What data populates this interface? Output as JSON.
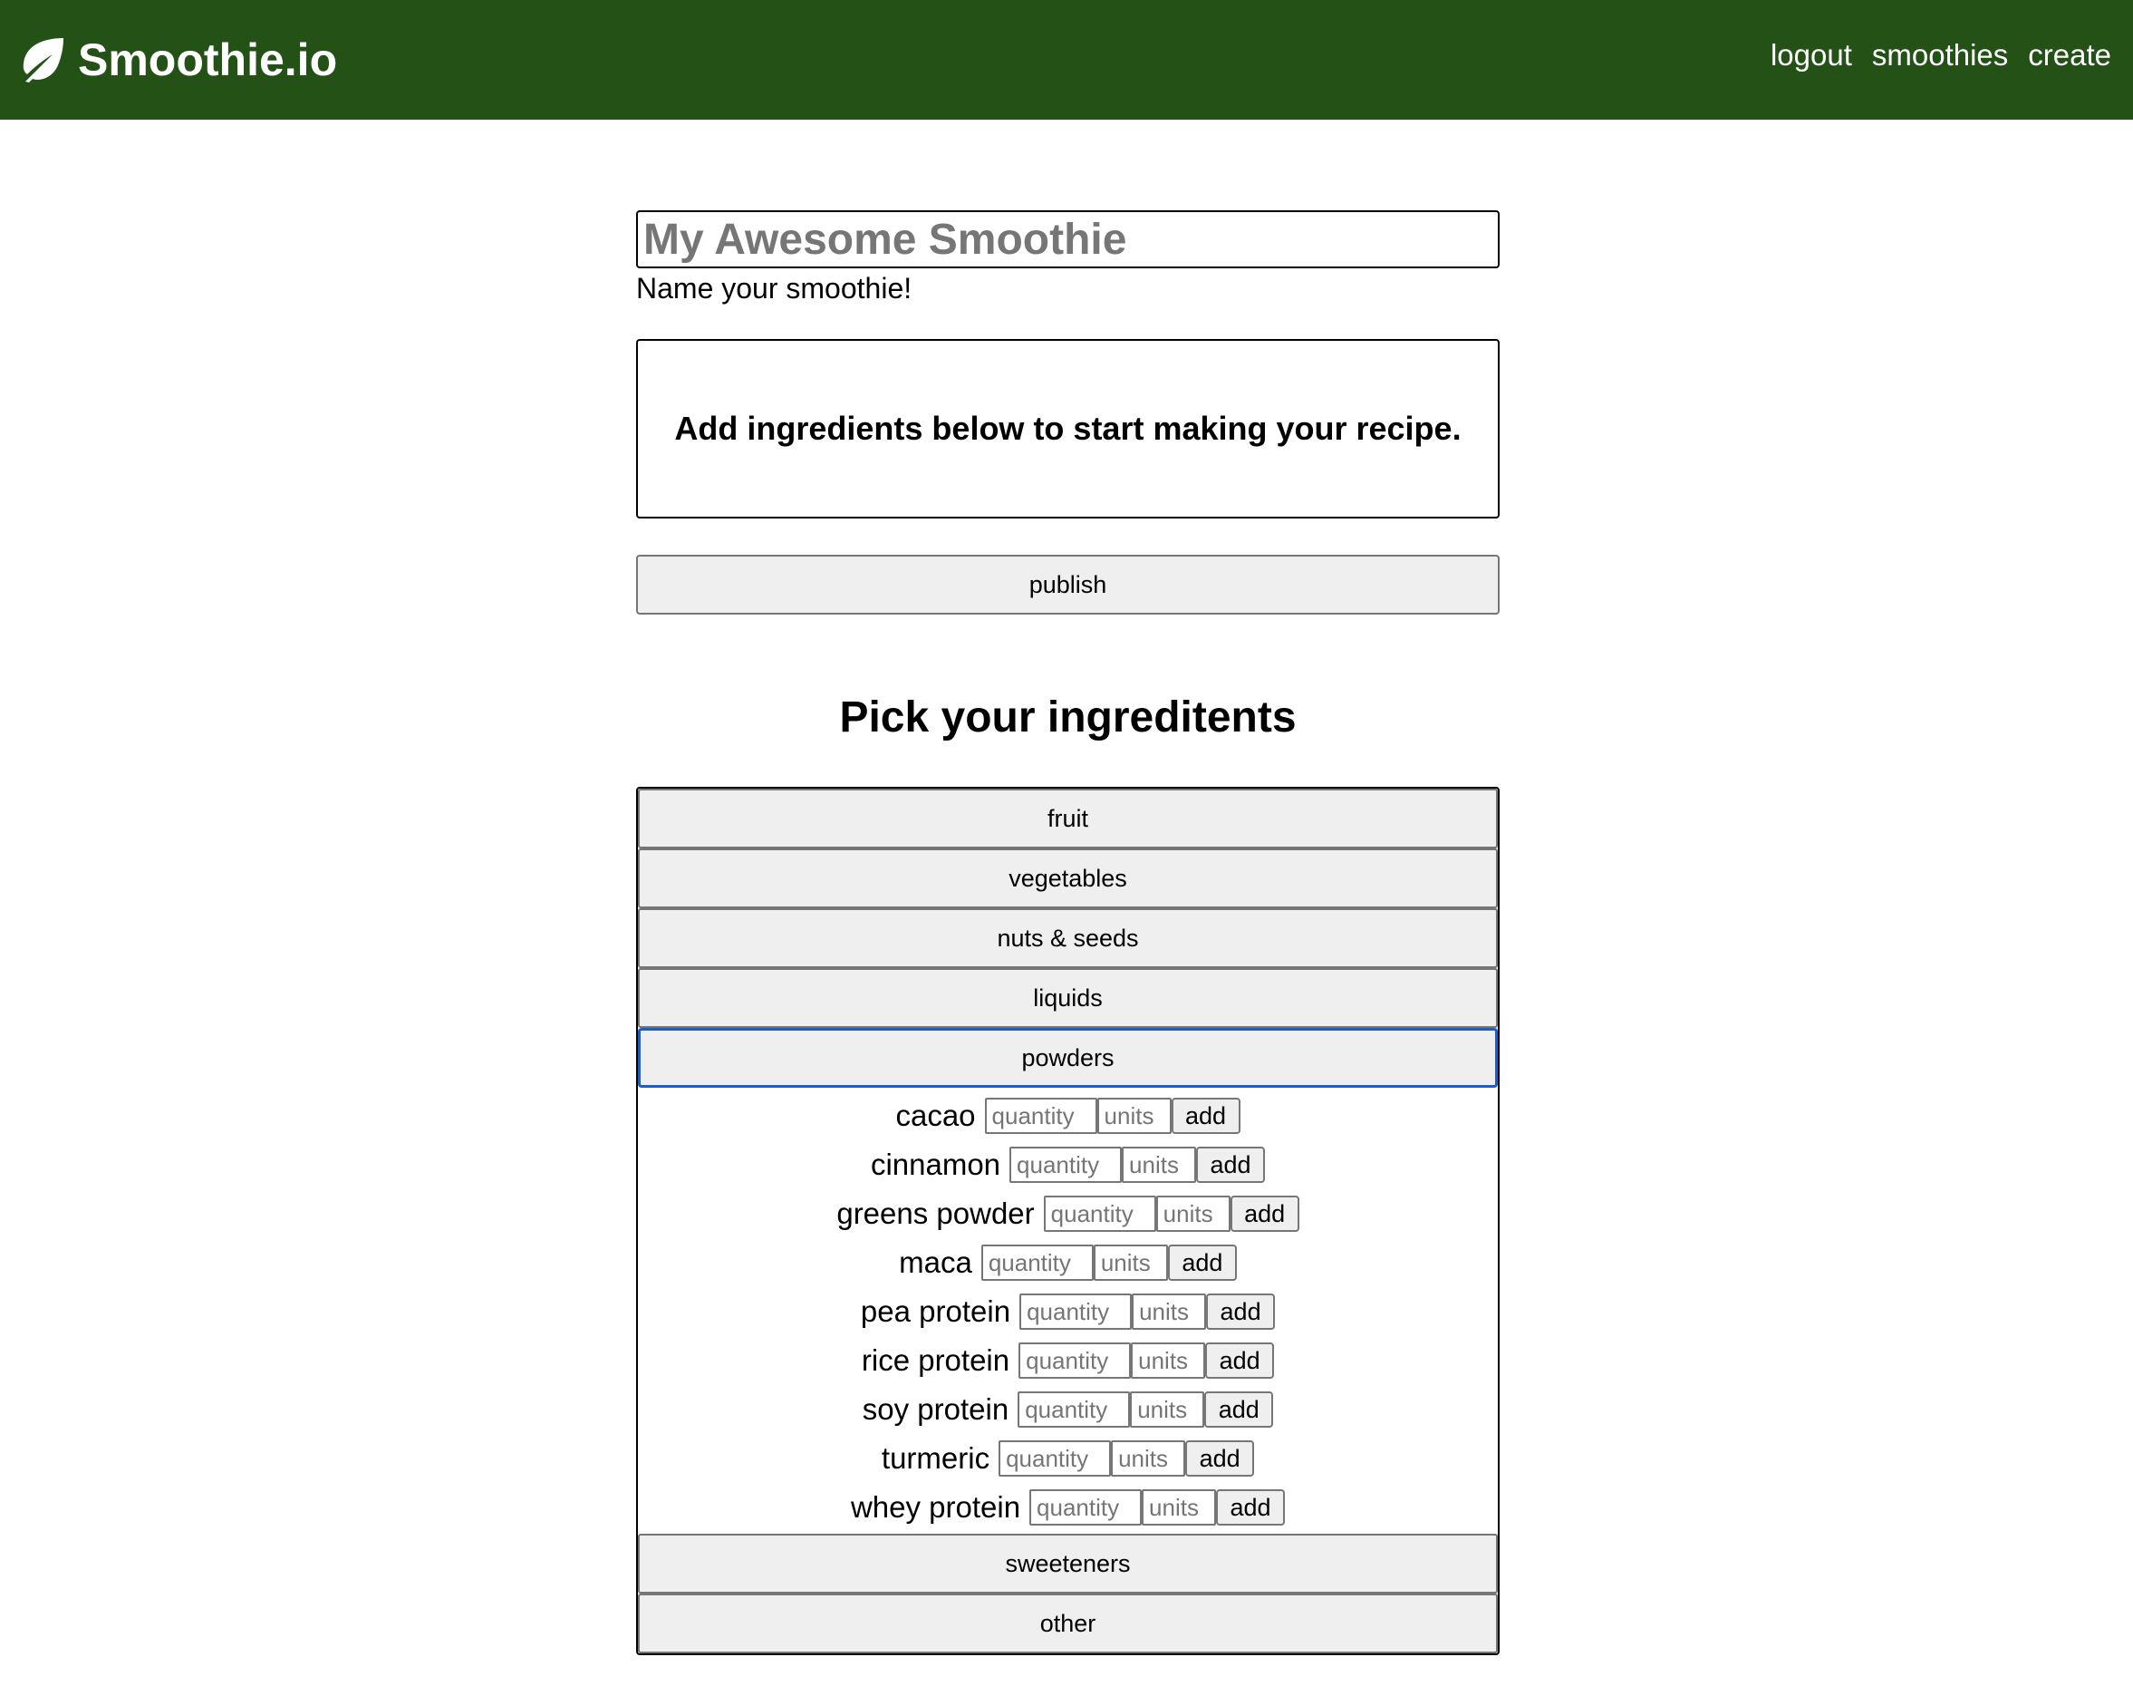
{
  "header": {
    "brand": "Smoothie.io",
    "nav": [
      "logout",
      "smoothies",
      "create"
    ],
    "logo_icon": "leaf-icon",
    "bg_color": "#235116"
  },
  "form": {
    "name_placeholder": "My Awesome Smoothie",
    "name_help": "Name your smoothie!",
    "recipe_empty_message": "Add ingredients below to start making your recipe.",
    "publish_label": "publish"
  },
  "picker": {
    "title": "Pick your ingreditents",
    "categories_before": [
      "fruit",
      "vegetables",
      "nuts & seeds",
      "liquids"
    ],
    "open_category": "powders",
    "categories_after": [
      "sweeteners",
      "other"
    ],
    "qty_placeholder": "quantity",
    "units_placeholder": "units",
    "add_label": "add",
    "ingredients": [
      "cacao",
      "cinnamon",
      "greens powder",
      "maca",
      "pea protein",
      "rice protein",
      "soy protein",
      "turmeric",
      "whey protein"
    ]
  }
}
